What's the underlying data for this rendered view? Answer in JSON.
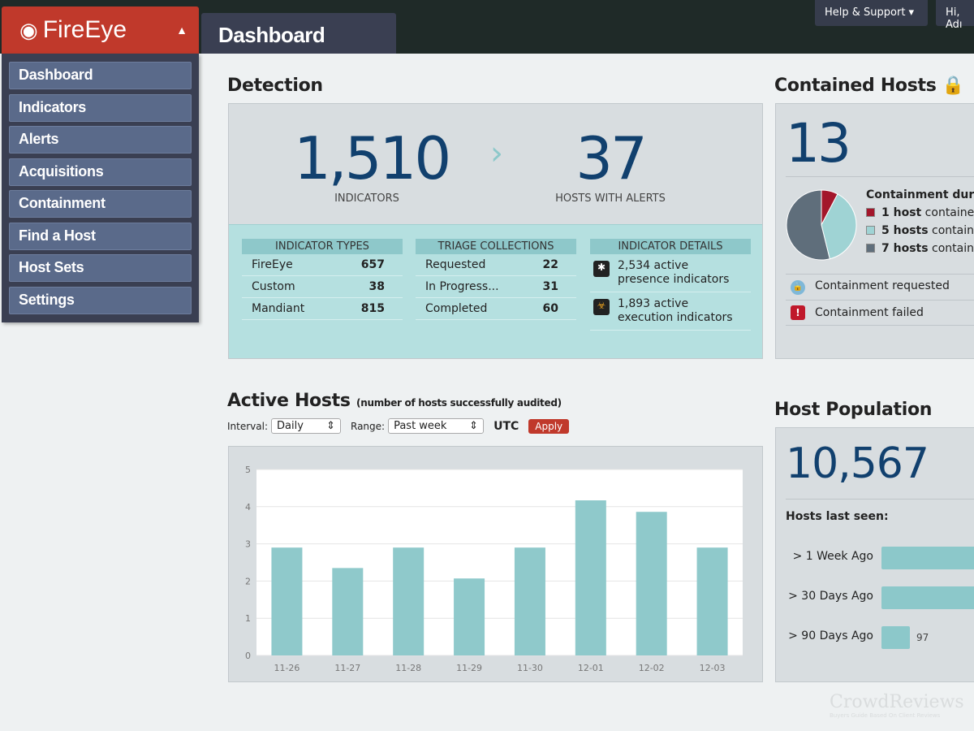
{
  "header": {
    "logo": "FireEye",
    "page_title": "Dashboard",
    "help": "Help & Support ▾",
    "user": "Hi, Adı"
  },
  "nav": [
    "Dashboard",
    "Indicators",
    "Alerts",
    "Acquisitions",
    "Containment",
    "Find a Host",
    "Host Sets",
    "Settings"
  ],
  "detection": {
    "title": "Detection",
    "indicators": "1,510",
    "indicators_label": "INDICATORS",
    "hosts": "37",
    "hosts_label": "HOSTS WITH ALERTS",
    "indicator_types": {
      "title": "INDICATOR TYPES",
      "rows": [
        [
          "FireEye",
          "657"
        ],
        [
          "Custom",
          "38"
        ],
        [
          "Mandiant",
          "815"
        ]
      ]
    },
    "triage": {
      "title": "TRIAGE COLLECTIONS",
      "rows": [
        [
          "Requested",
          "22"
        ],
        [
          "In Progress...",
          "31"
        ],
        [
          "Completed",
          "60"
        ]
      ]
    },
    "details": {
      "title": "INDICATOR DETAILS",
      "rows": [
        "2,534 active presence indicators",
        "1,893 active execution indicators"
      ]
    }
  },
  "contained": {
    "title": "Contained Hosts",
    "count": "13",
    "duration_title": "Containment durat",
    "legend": [
      {
        "bold": "1 host",
        "text": " containec",
        "color": "#a3162b",
        "value": 1
      },
      {
        "bold": "5 hosts",
        "text": " containe",
        "color": "#9fd3d4",
        "value": 5
      },
      {
        "bold": "7 hosts",
        "text": " containe",
        "color": "#5f6e7b",
        "value": 7
      }
    ],
    "status": [
      "Containment requested",
      "Containment failed"
    ]
  },
  "active": {
    "title": "Active Hosts",
    "subtitle": "(number of hosts successfully audited)",
    "interval_label": "Interval:",
    "interval": "Daily",
    "range_label": "Range:",
    "range": "Past week",
    "tz": "UTC",
    "apply": "Apply"
  },
  "chart_data": {
    "type": "bar",
    "categories": [
      "11-26",
      "11-27",
      "11-28",
      "11-29",
      "11-30",
      "12-01",
      "12-02",
      "12-03"
    ],
    "values": [
      2.9,
      2.35,
      2.9,
      2.07,
      2.9,
      4.17,
      3.86,
      2.9
    ],
    "ylim": [
      0,
      5
    ],
    "yticks": [
      "0",
      "1",
      "2",
      "3",
      "4",
      "5"
    ],
    "color": "#8fc9cb"
  },
  "population": {
    "title": "Host Population",
    "count": "10,567",
    "last_seen": "Hosts last seen:",
    "rows": [
      {
        "label": "> 1 Week Ago",
        "value": ""
      },
      {
        "label": "> 30 Days Ago",
        "value": ""
      },
      {
        "label": "> 90 Days Ago",
        "value": "97"
      }
    ]
  },
  "watermark": {
    "name": "CrowdReviews",
    "tag": "Buyers Guide Based On Client Reviews"
  }
}
